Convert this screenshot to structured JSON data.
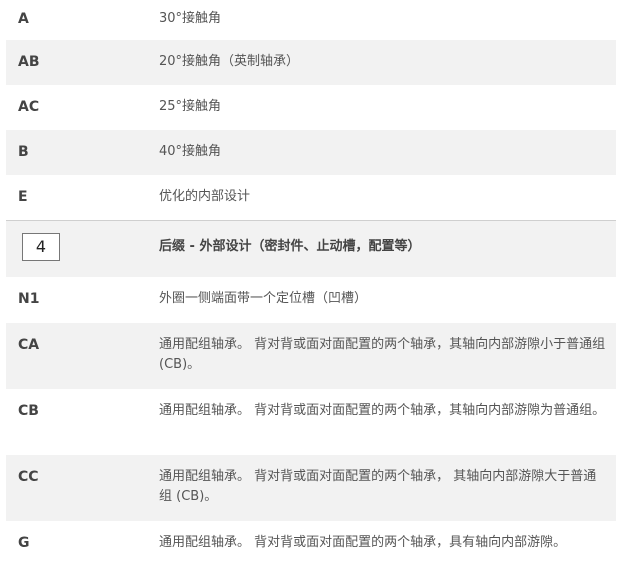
{
  "rows": [
    {
      "code": "A",
      "description": "30°接触角"
    },
    {
      "code": "AB",
      "description": "20°接触角（英制轴承）"
    },
    {
      "code": "AC",
      "description": "25°接触角"
    },
    {
      "code": "B",
      "description": "40°接触角"
    },
    {
      "code": "E",
      "description": "优化的内部设计"
    },
    {
      "code": "4",
      "description": "后缀 - 外部设计（密封件、止动槽，配置等）"
    },
    {
      "code": "N1",
      "description": "外圈一侧端面带一个定位槽（凹槽）"
    },
    {
      "code": "CA",
      "description": "通用配组轴承。 背对背或面对面配置的两个轴承，其轴向内部游隙小于普通组 (CB)。"
    },
    {
      "code": "CB",
      "description": "通用配组轴承。 背对背或面对面配置的两个轴承，其轴向内部游隙为普通组。"
    },
    {
      "code": "CC",
      "description": "通用配组轴承。 背对背或面对面配置的两个轴承， 其轴向内部游隙大于普通组 (CB)。"
    },
    {
      "code": "G",
      "description": "通用配组轴承。 背对背或面对面配置的两个轴承，具有轴向内部游隙。"
    }
  ],
  "colors": {
    "shaded_row": "#f2f2f2",
    "text": "#555555",
    "code_text": "#444444",
    "divider": "#cfcfcf"
  }
}
